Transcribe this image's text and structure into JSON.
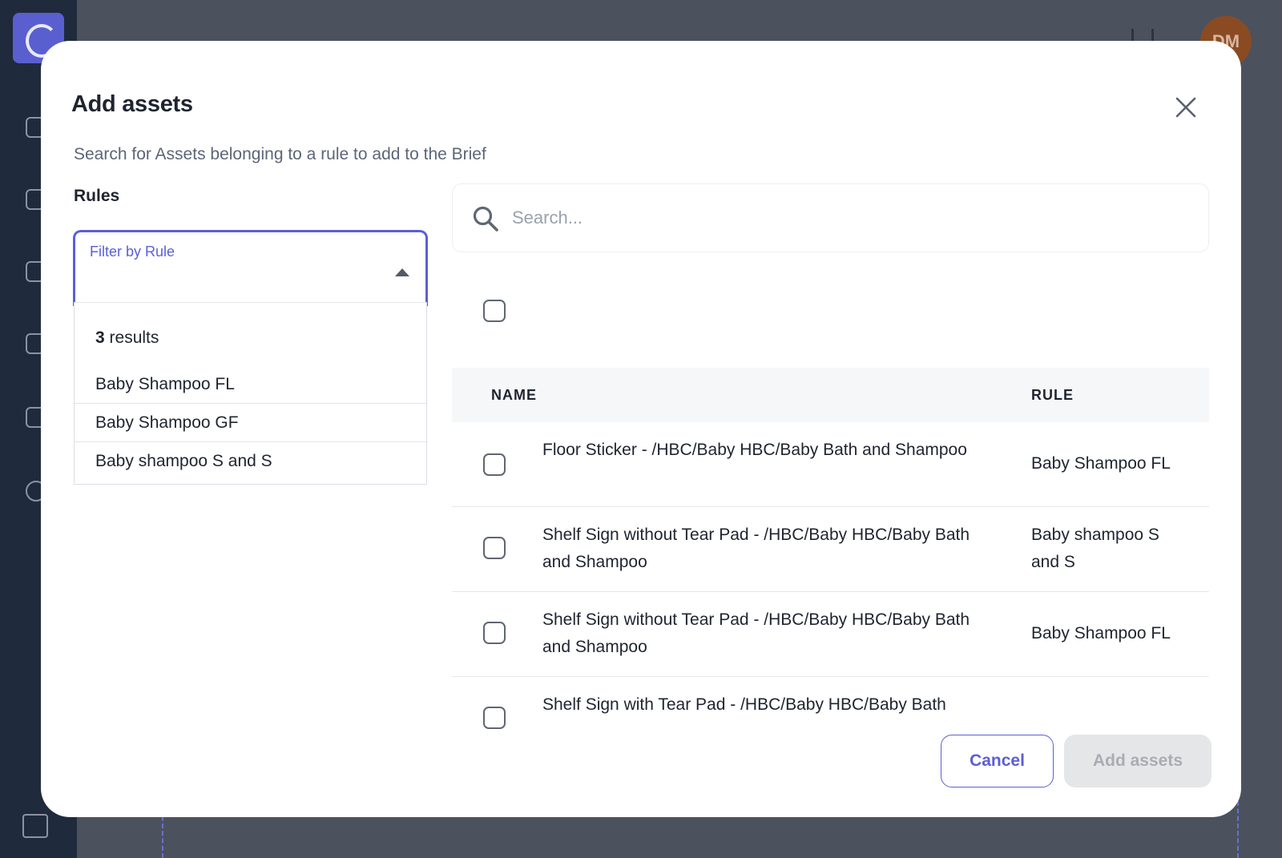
{
  "background": {
    "avatar_initials": "DM"
  },
  "modal": {
    "title": "Add assets",
    "subtitle": "Search for Assets belonging to a rule to add to the Brief",
    "rules_label": "Rules",
    "filter": {
      "label": "Filter by Rule",
      "results_count": "3",
      "results_suffix": " results",
      "options": [
        "Baby Shampoo FL",
        "Baby Shampoo GF",
        "Baby shampoo S and S"
      ]
    },
    "search": {
      "placeholder": "Search..."
    },
    "table": {
      "columns": {
        "name": "NAME",
        "rule": "RULE"
      },
      "rows": [
        {
          "name": "Floor Sticker - /HBC/Baby HBC/Baby Bath and Shampoo",
          "rule": "Baby Shampoo FL"
        },
        {
          "name": "Shelf Sign without Tear Pad - /HBC/Baby HBC/Baby Bath and Shampoo",
          "rule": "Baby shampoo S and S"
        },
        {
          "name": "Shelf Sign without Tear Pad - /HBC/Baby HBC/Baby Bath and Shampoo",
          "rule": "Baby Shampoo FL"
        },
        {
          "name": "Shelf Sign with Tear Pad - /HBC/Baby HBC/Baby Bath",
          "rule": ""
        }
      ]
    },
    "buttons": {
      "cancel": "Cancel",
      "add": "Add assets"
    }
  },
  "colors": {
    "accent": "#5b5fd6",
    "overlay": "#4b525d",
    "sidebar": "#1f2b3c"
  }
}
